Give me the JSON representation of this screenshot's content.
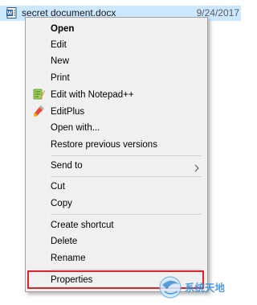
{
  "file": {
    "name": "secret document.docx",
    "date": "9/24/2017",
    "icon": "word-document-icon"
  },
  "menu": {
    "items": [
      {
        "label": "Open",
        "bold": true
      },
      {
        "label": "Edit"
      },
      {
        "label": "New"
      },
      {
        "label": "Print"
      },
      {
        "label": "Edit with Notepad++",
        "icon": "notepad-plus-plus-icon"
      },
      {
        "label": "EditPlus",
        "icon": "editplus-icon"
      },
      {
        "label": "Open with..."
      },
      {
        "label": "Restore previous versions"
      },
      {
        "label": "Send to",
        "submenu": true
      },
      {
        "label": "Cut"
      },
      {
        "label": "Copy"
      },
      {
        "label": "Create shortcut"
      },
      {
        "label": "Delete"
      },
      {
        "label": "Rename"
      },
      {
        "label": "Properties",
        "highlighted": true
      }
    ]
  },
  "watermark": {
    "text": "系统天地"
  },
  "colors": {
    "selection": "#cce8ff",
    "menu_background": "#f0f0f0",
    "highlight_border": "#d9262b",
    "watermark": "#3a8fd6"
  }
}
